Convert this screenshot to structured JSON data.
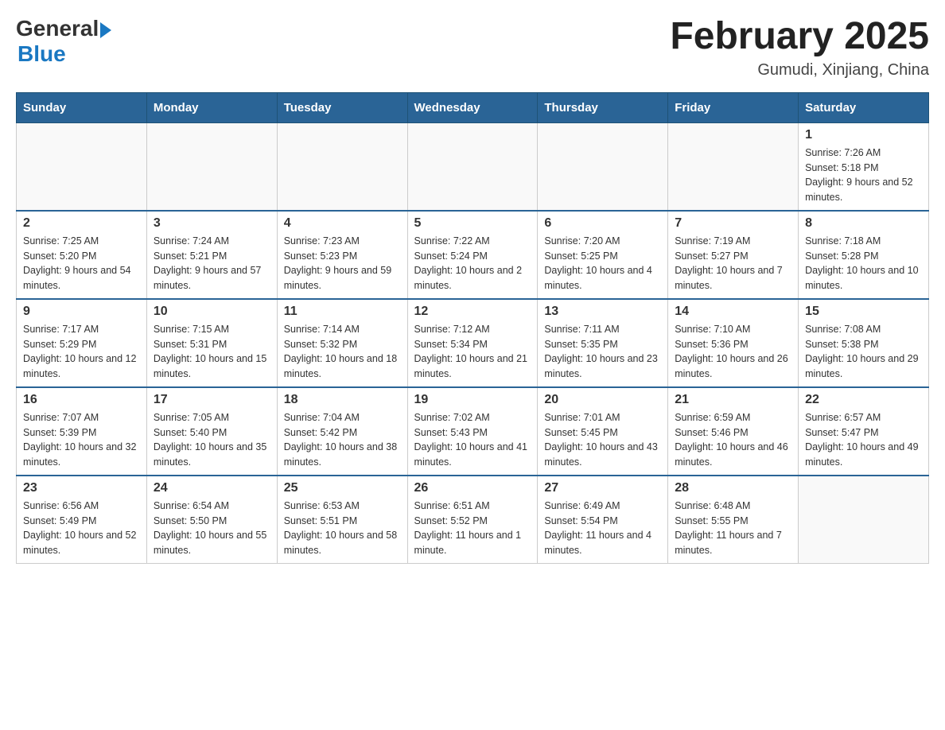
{
  "header": {
    "logo_general": "General",
    "logo_blue": "Blue",
    "month_title": "February 2025",
    "location": "Gumudi, Xinjiang, China"
  },
  "days_of_week": [
    "Sunday",
    "Monday",
    "Tuesday",
    "Wednesday",
    "Thursday",
    "Friday",
    "Saturday"
  ],
  "weeks": [
    [
      {
        "day": "",
        "info": ""
      },
      {
        "day": "",
        "info": ""
      },
      {
        "day": "",
        "info": ""
      },
      {
        "day": "",
        "info": ""
      },
      {
        "day": "",
        "info": ""
      },
      {
        "day": "",
        "info": ""
      },
      {
        "day": "1",
        "info": "Sunrise: 7:26 AM\nSunset: 5:18 PM\nDaylight: 9 hours and 52 minutes."
      }
    ],
    [
      {
        "day": "2",
        "info": "Sunrise: 7:25 AM\nSunset: 5:20 PM\nDaylight: 9 hours and 54 minutes."
      },
      {
        "day": "3",
        "info": "Sunrise: 7:24 AM\nSunset: 5:21 PM\nDaylight: 9 hours and 57 minutes."
      },
      {
        "day": "4",
        "info": "Sunrise: 7:23 AM\nSunset: 5:23 PM\nDaylight: 9 hours and 59 minutes."
      },
      {
        "day": "5",
        "info": "Sunrise: 7:22 AM\nSunset: 5:24 PM\nDaylight: 10 hours and 2 minutes."
      },
      {
        "day": "6",
        "info": "Sunrise: 7:20 AM\nSunset: 5:25 PM\nDaylight: 10 hours and 4 minutes."
      },
      {
        "day": "7",
        "info": "Sunrise: 7:19 AM\nSunset: 5:27 PM\nDaylight: 10 hours and 7 minutes."
      },
      {
        "day": "8",
        "info": "Sunrise: 7:18 AM\nSunset: 5:28 PM\nDaylight: 10 hours and 10 minutes."
      }
    ],
    [
      {
        "day": "9",
        "info": "Sunrise: 7:17 AM\nSunset: 5:29 PM\nDaylight: 10 hours and 12 minutes."
      },
      {
        "day": "10",
        "info": "Sunrise: 7:15 AM\nSunset: 5:31 PM\nDaylight: 10 hours and 15 minutes."
      },
      {
        "day": "11",
        "info": "Sunrise: 7:14 AM\nSunset: 5:32 PM\nDaylight: 10 hours and 18 minutes."
      },
      {
        "day": "12",
        "info": "Sunrise: 7:12 AM\nSunset: 5:34 PM\nDaylight: 10 hours and 21 minutes."
      },
      {
        "day": "13",
        "info": "Sunrise: 7:11 AM\nSunset: 5:35 PM\nDaylight: 10 hours and 23 minutes."
      },
      {
        "day": "14",
        "info": "Sunrise: 7:10 AM\nSunset: 5:36 PM\nDaylight: 10 hours and 26 minutes."
      },
      {
        "day": "15",
        "info": "Sunrise: 7:08 AM\nSunset: 5:38 PM\nDaylight: 10 hours and 29 minutes."
      }
    ],
    [
      {
        "day": "16",
        "info": "Sunrise: 7:07 AM\nSunset: 5:39 PM\nDaylight: 10 hours and 32 minutes."
      },
      {
        "day": "17",
        "info": "Sunrise: 7:05 AM\nSunset: 5:40 PM\nDaylight: 10 hours and 35 minutes."
      },
      {
        "day": "18",
        "info": "Sunrise: 7:04 AM\nSunset: 5:42 PM\nDaylight: 10 hours and 38 minutes."
      },
      {
        "day": "19",
        "info": "Sunrise: 7:02 AM\nSunset: 5:43 PM\nDaylight: 10 hours and 41 minutes."
      },
      {
        "day": "20",
        "info": "Sunrise: 7:01 AM\nSunset: 5:45 PM\nDaylight: 10 hours and 43 minutes."
      },
      {
        "day": "21",
        "info": "Sunrise: 6:59 AM\nSunset: 5:46 PM\nDaylight: 10 hours and 46 minutes."
      },
      {
        "day": "22",
        "info": "Sunrise: 6:57 AM\nSunset: 5:47 PM\nDaylight: 10 hours and 49 minutes."
      }
    ],
    [
      {
        "day": "23",
        "info": "Sunrise: 6:56 AM\nSunset: 5:49 PM\nDaylight: 10 hours and 52 minutes."
      },
      {
        "day": "24",
        "info": "Sunrise: 6:54 AM\nSunset: 5:50 PM\nDaylight: 10 hours and 55 minutes."
      },
      {
        "day": "25",
        "info": "Sunrise: 6:53 AM\nSunset: 5:51 PM\nDaylight: 10 hours and 58 minutes."
      },
      {
        "day": "26",
        "info": "Sunrise: 6:51 AM\nSunset: 5:52 PM\nDaylight: 11 hours and 1 minute."
      },
      {
        "day": "27",
        "info": "Sunrise: 6:49 AM\nSunset: 5:54 PM\nDaylight: 11 hours and 4 minutes."
      },
      {
        "day": "28",
        "info": "Sunrise: 6:48 AM\nSunset: 5:55 PM\nDaylight: 11 hours and 7 minutes."
      },
      {
        "day": "",
        "info": ""
      }
    ]
  ]
}
